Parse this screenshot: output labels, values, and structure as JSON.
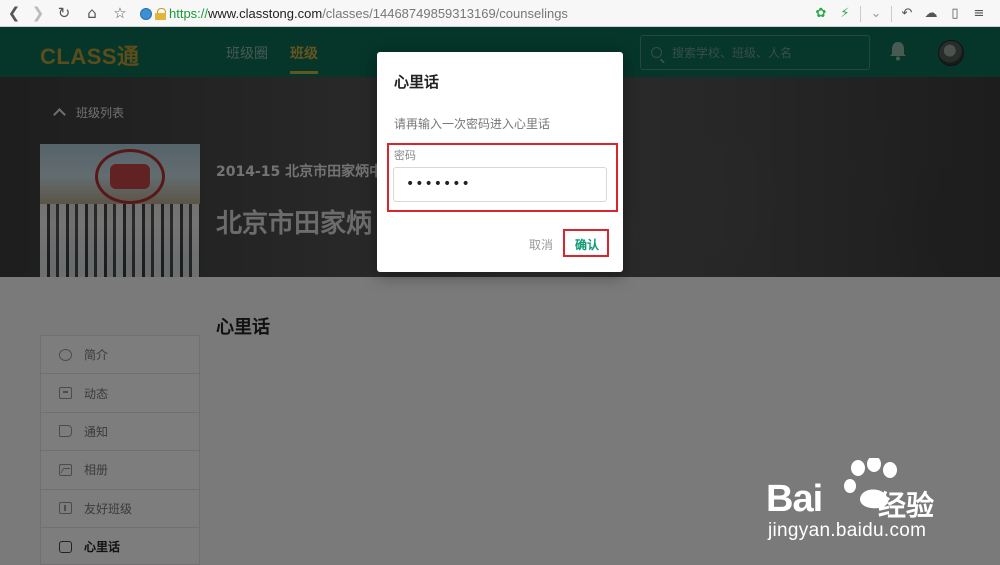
{
  "browser": {
    "url_scheme": "https://",
    "url_host": "www.classtong.com",
    "url_path": "/classes/14468749859313169/counselings"
  },
  "header": {
    "logo": "CLASS通",
    "nav": [
      "班级圈",
      "班级"
    ],
    "search_placeholder": "搜索学校、班级、人名"
  },
  "banner": {
    "back_label": "班级列表",
    "subtitle": "2014-15 北京市田家炳中",
    "title": "北京市田家炳"
  },
  "section_title": "心里话",
  "sidebar": {
    "items": [
      {
        "label": "简介",
        "icon": "copyright-icon"
      },
      {
        "label": "动态",
        "icon": "chat-icon"
      },
      {
        "label": "通知",
        "icon": "speaker-icon"
      },
      {
        "label": "相册",
        "icon": "photo-icon"
      },
      {
        "label": "友好班级",
        "icon": "friend-icon"
      },
      {
        "label": "心里话",
        "icon": "lock-icon"
      }
    ],
    "active_index": 5
  },
  "dialog": {
    "title": "心里话",
    "message": "请再输入一次密码进入心里话",
    "field_label": "密码",
    "password_value": "•••••••",
    "cancel_label": "取消",
    "confirm_label": "确认"
  },
  "watermark": {
    "brand": "Bai",
    "jingyan": "经验",
    "url": "jingyan.baidu.com"
  },
  "colors": {
    "header_bg": "#0c6a52",
    "brand_gold": "#c9a843",
    "confirm_green": "#0e9a72",
    "highlight_red": "#d9252b"
  }
}
